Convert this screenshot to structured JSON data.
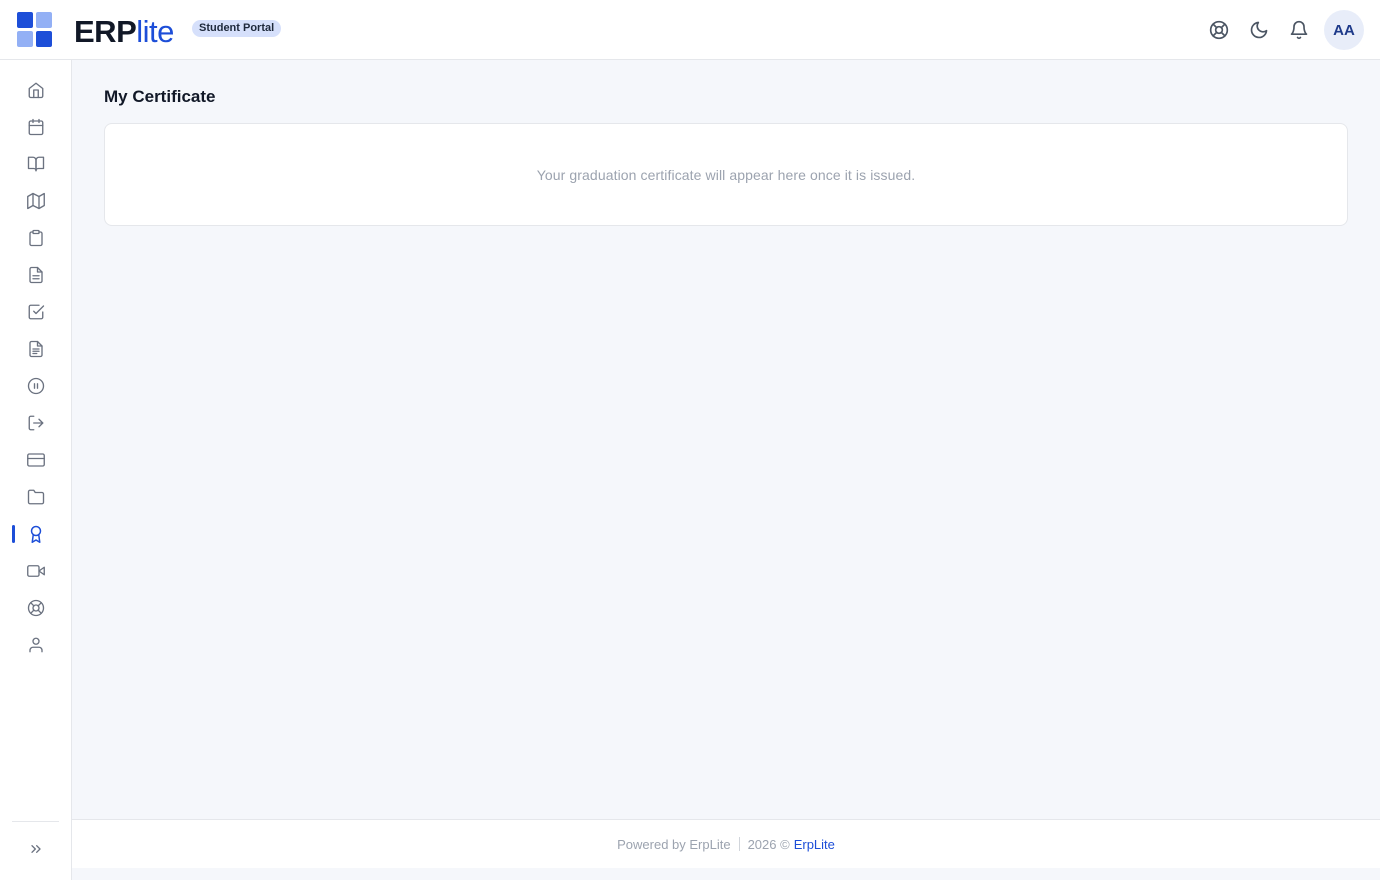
{
  "brand": {
    "logo_part1": "ERP",
    "logo_part2": "lite",
    "portal_badge": "Student Portal",
    "colors": {
      "accent": "#1d4ed8",
      "accent_light": "#93b0f5",
      "badge_bg": "#d6e0fb"
    }
  },
  "header": {
    "icons": [
      "lifebuoy-icon",
      "moon-icon",
      "bell-icon"
    ],
    "avatar_initials": "AA"
  },
  "sidebar": {
    "items": [
      {
        "icon": "home-icon",
        "active": false
      },
      {
        "icon": "calendar-icon",
        "active": false
      },
      {
        "icon": "book-open-icon",
        "active": false
      },
      {
        "icon": "map-icon",
        "active": false
      },
      {
        "icon": "clipboard-icon",
        "active": false
      },
      {
        "icon": "file-text-icon",
        "active": false
      },
      {
        "icon": "check-square-icon",
        "active": false
      },
      {
        "icon": "document-icon",
        "active": false
      },
      {
        "icon": "pause-circle-icon",
        "active": false
      },
      {
        "icon": "logout-icon",
        "active": false
      },
      {
        "icon": "credit-card-icon",
        "active": false
      },
      {
        "icon": "folder-icon",
        "active": false
      },
      {
        "icon": "award-icon",
        "active": true
      },
      {
        "icon": "video-icon",
        "active": false
      },
      {
        "icon": "lifebuoy-icon",
        "active": false
      },
      {
        "icon": "user-icon",
        "active": false
      }
    ],
    "collapse_icon": "chevrons-right-icon"
  },
  "main": {
    "title": "My Certificate",
    "empty_message": "Your graduation certificate will appear here once it is issued."
  },
  "footer": {
    "powered_by": "Powered by ErpLite",
    "copyright": "2026 ©",
    "link_text": "ErpLite"
  }
}
